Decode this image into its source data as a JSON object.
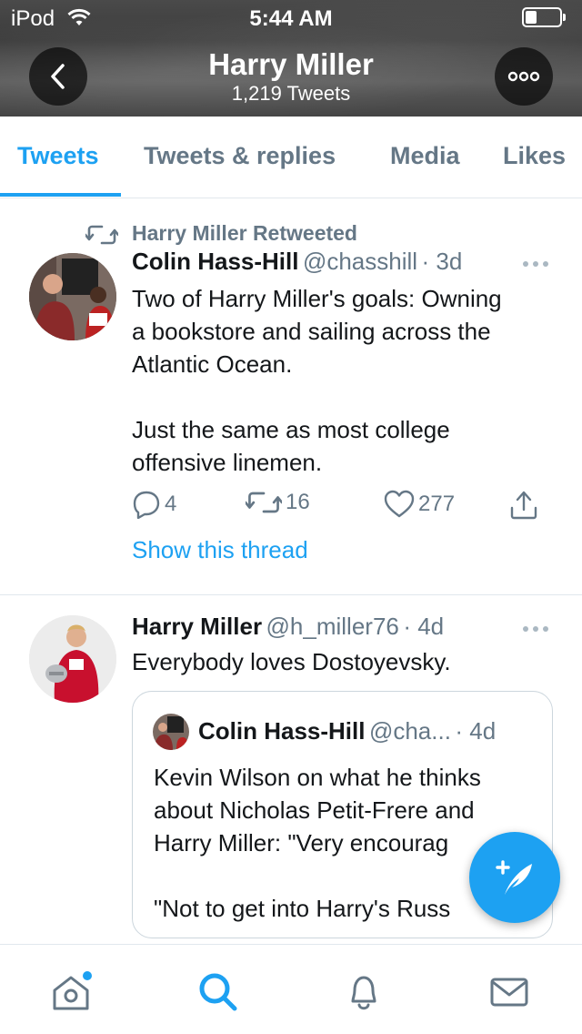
{
  "status_bar": {
    "carrier": "iPod",
    "time": "5:44 AM"
  },
  "header": {
    "name": "Harry Miller",
    "tweet_count": "1,219 Tweets"
  },
  "tabs": [
    {
      "label": "Tweets",
      "active": true
    },
    {
      "label": "Tweets & replies",
      "active": false
    },
    {
      "label": "Media",
      "active": false
    },
    {
      "label": "Likes",
      "active": false
    }
  ],
  "tweet1": {
    "retweet_label": "Harry Miller Retweeted",
    "author": "Colin Hass-Hill",
    "handle": "@chasshill",
    "age": "· 3d",
    "text_lines": [
      "Two of Harry Miller's goals: Owning",
      "a bookstore and sailing across the",
      "Atlantic Ocean.",
      "",
      "Just the same as most college",
      "offensive linemen."
    ],
    "replies": "4",
    "retweets": "16",
    "likes": "277",
    "thread_link": "Show this thread"
  },
  "tweet2": {
    "author": "Harry Miller",
    "handle": "@h_miller76",
    "age": "· 4d",
    "text": "Everybody loves Dostoyevsky.",
    "quote": {
      "author": "Colin Hass-Hill",
      "handle": "@cha...",
      "age": "· 4d",
      "text_lines": [
        "Kevin Wilson on what he thinks",
        "about Nicholas Petit-Frere and",
        "Harry Miller: \"Very encourag",
        "",
        "\"Not to get into Harry's Russ"
      ]
    }
  },
  "colors": {
    "accent": "#1da1f2",
    "secondary_text": "#657786",
    "divider": "#e1e8ed"
  },
  "icons": {
    "back": "chevron-left-icon",
    "more": "more-horizontal-icon",
    "retweet": "retweet-icon",
    "reply": "reply-icon",
    "like": "heart-icon",
    "share": "share-icon",
    "compose": "compose-feather-icon",
    "home": "home-icon",
    "search": "search-icon",
    "notifications": "bell-icon",
    "messages": "mail-icon"
  }
}
